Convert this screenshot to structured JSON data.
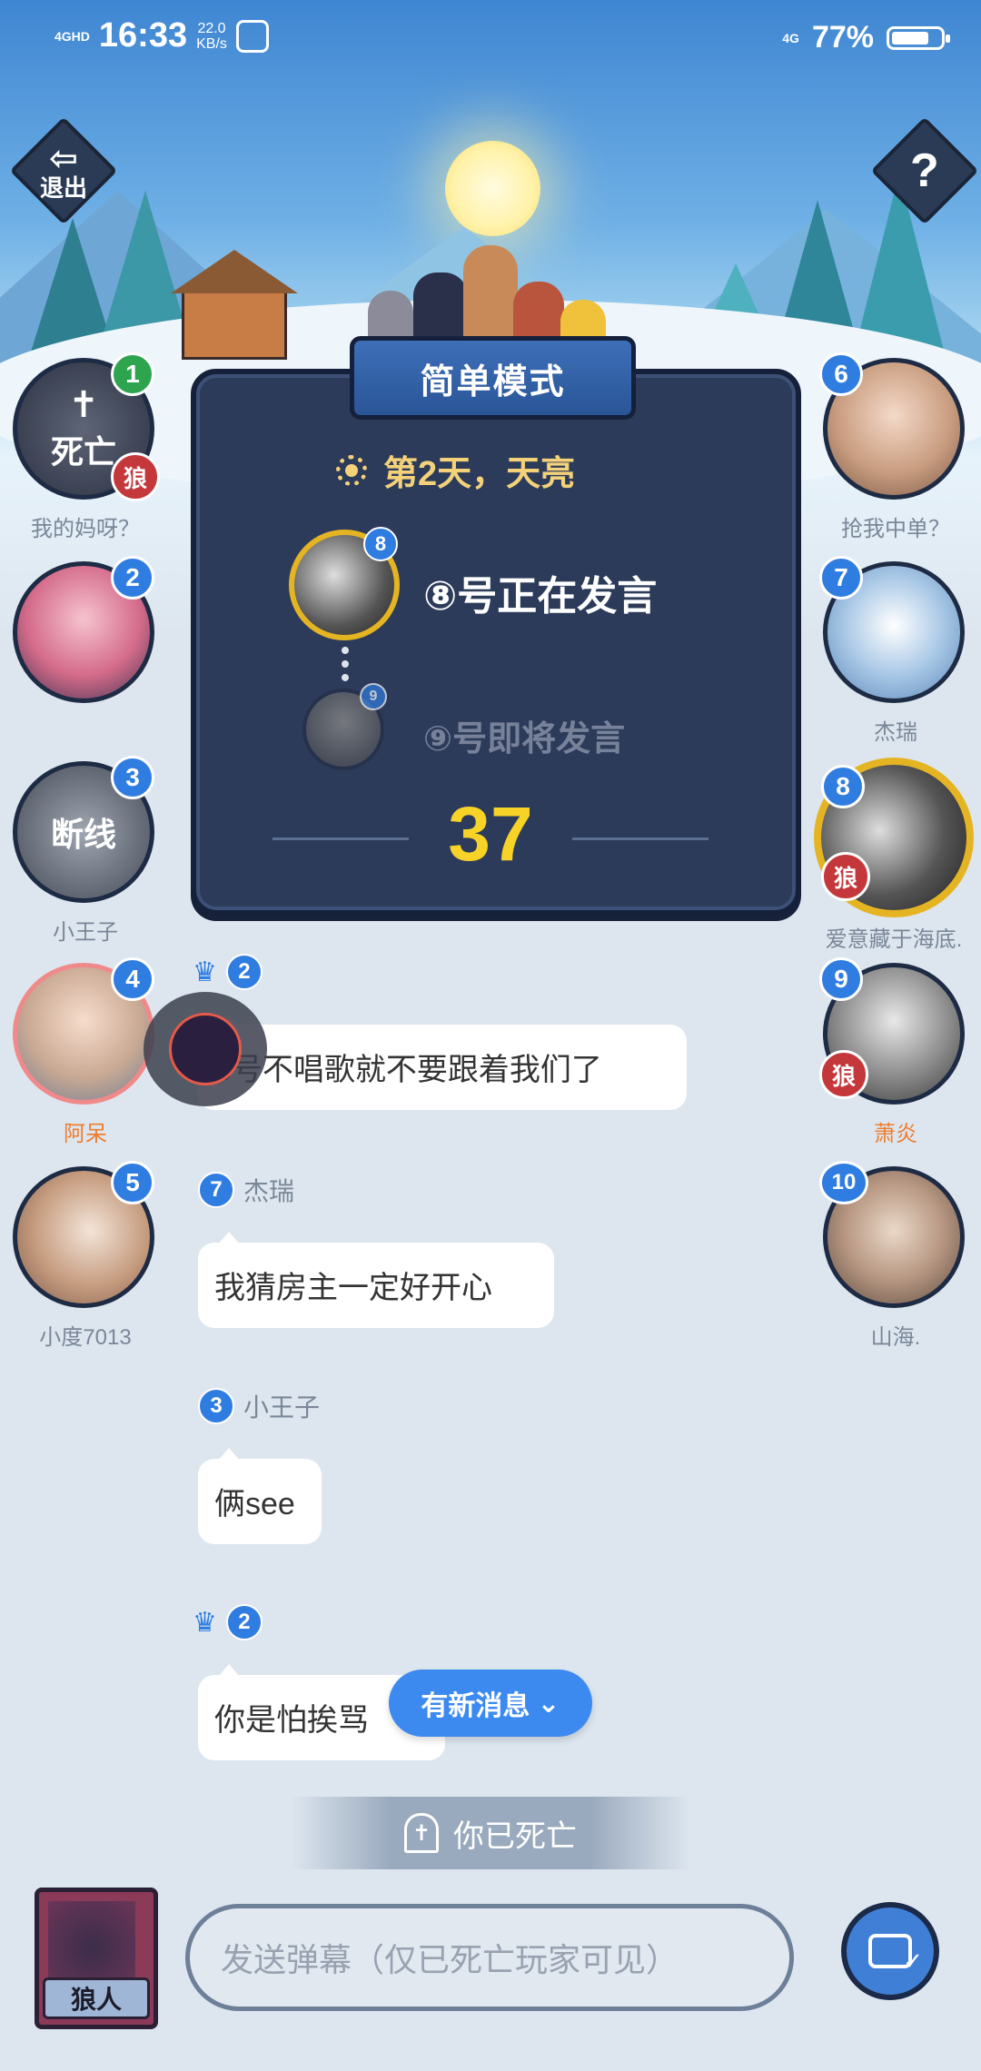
{
  "status_bar": {
    "network": "4GHD",
    "time": "16:33",
    "speed_value": "22.0",
    "speed_unit": "KB/s",
    "right_network": "4G",
    "battery": "77%",
    "battery_level": 0.77
  },
  "header": {
    "exit_label": "退出",
    "help_label": "?"
  },
  "panel": {
    "mode": "简单模式",
    "day": "第2天，天亮",
    "current_speaker": "⑧号正在发言",
    "current_badge": "8",
    "next_speaker": "⑨号即将发言",
    "next_badge": "9",
    "timer": "37"
  },
  "seats_left": [
    {
      "num": "1",
      "name": "我的妈呀？",
      "status": "死亡",
      "wolf": "狼"
    },
    {
      "num": "2",
      "name": ""
    },
    {
      "num": "3",
      "name": "小王子",
      "status": "断线"
    },
    {
      "num": "4",
      "name": "阿呆"
    },
    {
      "num": "5",
      "name": "小度7013"
    }
  ],
  "seats_right": [
    {
      "num": "6",
      "name": "抢我中单？"
    },
    {
      "num": "7",
      "name": "杰瑞"
    },
    {
      "num": "8",
      "name": "爱意藏于海底.",
      "wolf": "狼"
    },
    {
      "num": "9",
      "name": "萧炎",
      "wolf": "狼"
    },
    {
      "num": "10",
      "name": "山海."
    }
  ],
  "messages": [
    {
      "num": "2",
      "name": "",
      "text": "3号不唱歌就不要跟着我们了"
    },
    {
      "num": "7",
      "name": "杰瑞",
      "text": "我猜房主一定好开心"
    },
    {
      "num": "3",
      "name": "小王子",
      "text": "俩see"
    },
    {
      "num": "2",
      "name": "",
      "text": "你是怕挨骂"
    }
  ],
  "new_message_label": "有新消息",
  "dead_notice": "你已死亡",
  "role_label": "狼人",
  "danmu_placeholder": "发送弹幕（仅已死亡玩家可见）",
  "colors": {
    "accent": "#3c8af0",
    "timer": "#f7d327",
    "wolf": "#c4373a",
    "highlight_name": "#ee7d2e"
  }
}
